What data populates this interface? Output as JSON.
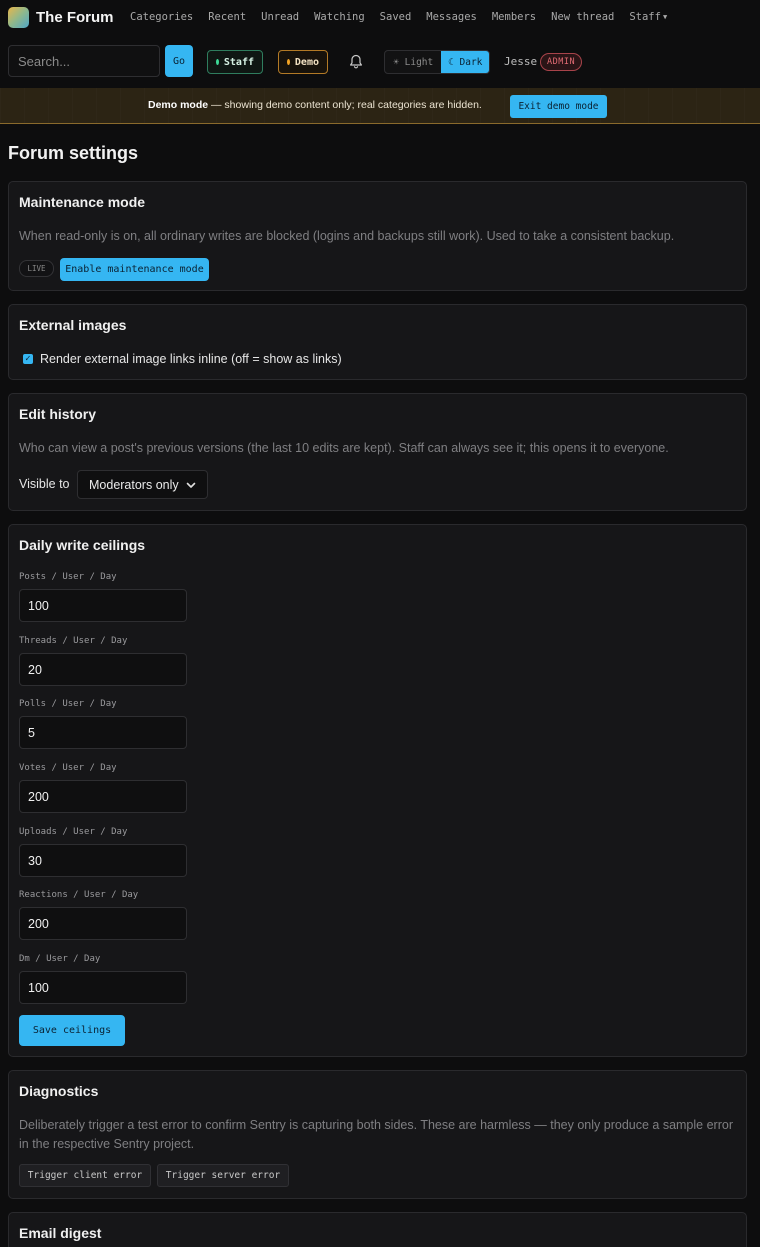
{
  "nav": {
    "brand": "The Forum",
    "links": [
      "Categories",
      "Recent",
      "Unread",
      "Watching",
      "Saved",
      "Messages",
      "Members",
      "New thread"
    ],
    "staff_menu": "Staff"
  },
  "toolbar": {
    "search_placeholder": "Search...",
    "go_label": "Go",
    "staff_pill": "Staff",
    "demo_pill": "Demo",
    "theme_light": "☀ Light",
    "theme_dark": "☾ Dark",
    "username": "Jesse",
    "role_badge": "ADMIN"
  },
  "demo_banner": {
    "strong": "Demo mode",
    "text": " — showing demo content only; real categories are hidden.",
    "exit_label": "Exit demo mode"
  },
  "page": {
    "title": "Forum settings"
  },
  "maintenance": {
    "title": "Maintenance mode",
    "description": "When read-only is on, all ordinary writes are blocked (logins and backups still work). Used to take a consistent backup.",
    "status": "LIVE",
    "button": "Enable maintenance mode"
  },
  "external_images": {
    "title": "External images",
    "checkbox_label": "Render external image links inline (off = show as links)",
    "checked": true
  },
  "edit_history": {
    "title": "Edit history",
    "description": "Who can view a post's previous versions (the last 10 edits are kept). Staff can always see it; this opens it to everyone.",
    "visible_label": "Visible to",
    "visible_value": "Moderators only"
  },
  "ceilings": {
    "title": "Daily write ceilings",
    "fields": [
      {
        "label": "Posts / User / Day",
        "value": "100"
      },
      {
        "label": "Threads / User / Day",
        "value": "20"
      },
      {
        "label": "Polls / User / Day",
        "value": "5"
      },
      {
        "label": "Votes / User / Day",
        "value": "200"
      },
      {
        "label": "Uploads / User / Day",
        "value": "30"
      },
      {
        "label": "Reactions / User / Day",
        "value": "200"
      },
      {
        "label": "Dm / User / Day",
        "value": "100"
      }
    ],
    "save_label": "Save ceilings"
  },
  "diagnostics": {
    "title": "Diagnostics",
    "description": "Deliberately trigger a test error to confirm Sentry is capturing both sides. These are harmless — they only produce a sample error in the respective Sentry project.",
    "client_btn": "Trigger client error",
    "server_btn": "Trigger server error"
  },
  "email_digest": {
    "title": "Email digest"
  },
  "colors": {
    "accent": "#35b6f2",
    "background": "#0d0d0e",
    "card": "#161618",
    "staff_green": "#3ddc97",
    "demo_orange": "#f5a524",
    "admin_red": "#e26b73"
  },
  "icons": {
    "logo": "forum-logo-icon",
    "bell": "bell-icon",
    "staff_caret": "chevron-down-icon",
    "select_chevron": "chevron-down-icon",
    "checkbox": "checkmark-icon"
  }
}
